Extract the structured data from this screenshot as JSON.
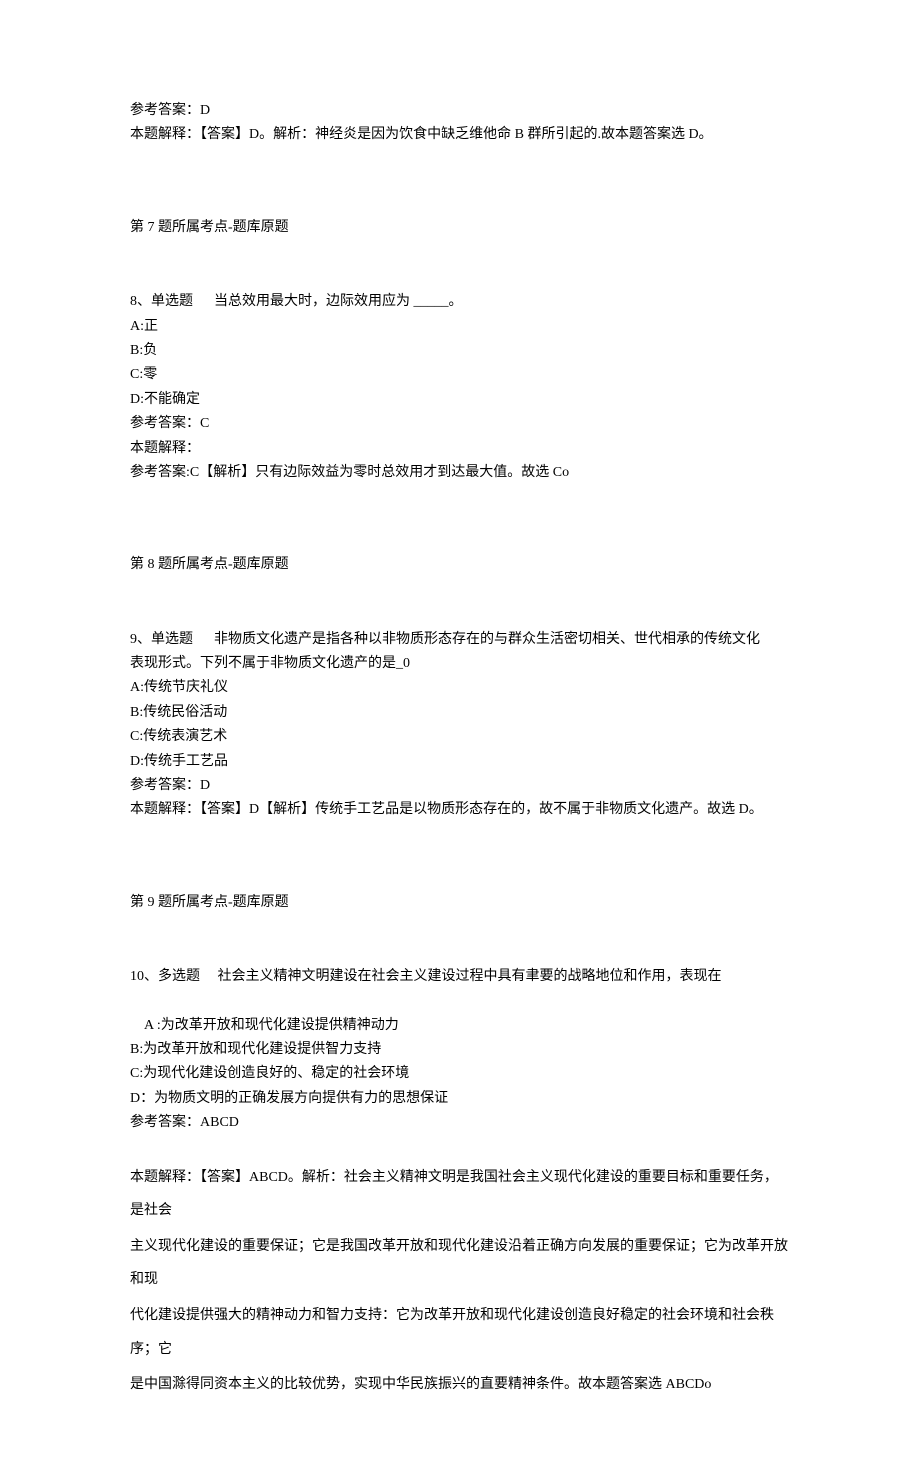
{
  "q7": {
    "ref_answer_label": "参考答案：D",
    "explanation": "本题解释：【答案】D。解析：神经炎是因为饮食中缺乏维他命 B 群所引起的.故本题答案选 D。",
    "topic": "第 7 题所属考点-题库原题"
  },
  "q8": {
    "number_label": "8、单选题",
    "stem": "当总效用最大时，边际效用应为 _____。",
    "option_a": "A:正",
    "option_b": "B:负",
    "option_c": "C:零",
    "option_d": "D:不能确定",
    "ref_answer_label": "参考答案：C",
    "explanation_label": "本题解释：",
    "explanation_body": "参考答案:C【解析】只有边际效益为零时总效用才到达最大值。故选 Co",
    "topic": "第 8 题所属考点-题库原题"
  },
  "q9": {
    "number_label": "9、单选题",
    "stem_line1": "非物质文化遗产是指各种以非物质形态存在的与群众生活密切相关、世代相承的传统文化",
    "stem_line2": "表现形式。下列不属于非物质文化遗产的是_0",
    "option_a": "A:传统节庆礼仪",
    "option_b": "B:传统民俗活动",
    "option_c": "C:传统表演艺术",
    "option_d": "D:传统手工艺品",
    "ref_answer_label": "参考答案：D",
    "explanation": "本题解释：【答案】D【解析】传统手工艺品是以物质形态存在的，故不属于非物质文化遗产。故选 D。",
    "topic": "第 9 题所属考点-题库原题"
  },
  "q10": {
    "number_label": "10、多选题",
    "stem": "社会主义精神文明建设在社会主义建设过程中具有聿要的战略地位和作用，表现在",
    "option_a": "A :为改革开放和现代化建设提供精神动力",
    "option_b": "B:为改革开放和现代化建设提供智力支持",
    "option_c": "C:为现代化建设创造良好的、稳定的社会环境",
    "option_d": "D：为物质文明的正确发展方向提供有力的思想保证",
    "ref_answer_label": "参考答案：ABCD",
    "explanation_p1": "本题解释：【答案】ABCD。解析：社会主义精神文明是我国社会主义现代化建设的重要目标和重要任务，是社会",
    "explanation_p2": "主义现代化建设的重要保证；它是我国改革开放和现代化建设沿着正确方向发展的重要保证；它为改革开放和现",
    "explanation_p3": "代化建设提供强大的精神动力和智力支持：它为改革开放和现代化建设创造良好稳定的社会环境和社会秩序；它",
    "explanation_p4": "是中国滁得同资本主义的比较优势，实现中华民族振兴的直要精神条件。故本题答案选 ABCDo"
  }
}
